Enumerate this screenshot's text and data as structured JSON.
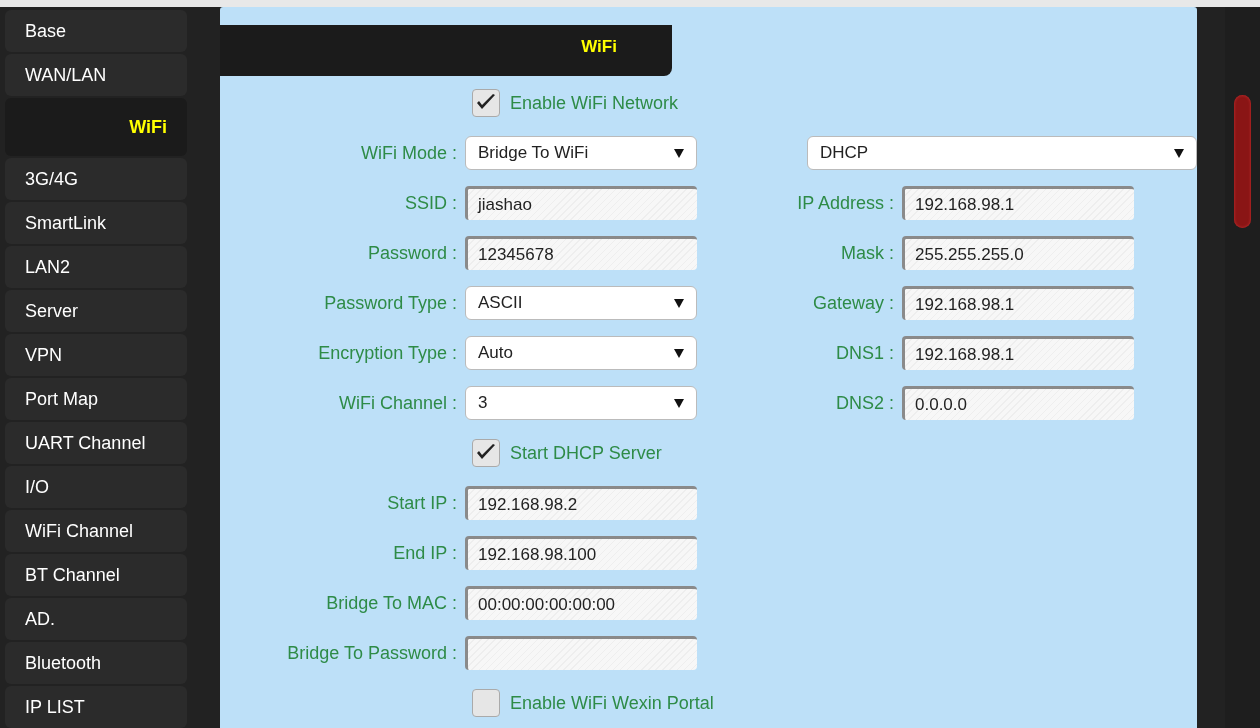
{
  "sidebar": {
    "items": [
      {
        "label": "Base",
        "selected": false
      },
      {
        "label": "WAN/LAN",
        "selected": false
      },
      {
        "label": "WiFi",
        "selected": true
      },
      {
        "label": "3G/4G",
        "selected": false
      },
      {
        "label": "SmartLink",
        "selected": false
      },
      {
        "label": "LAN2",
        "selected": false
      },
      {
        "label": "Server",
        "selected": false
      },
      {
        "label": "VPN",
        "selected": false
      },
      {
        "label": "Port Map",
        "selected": false
      },
      {
        "label": "UART Channel",
        "selected": false
      },
      {
        "label": "I/O",
        "selected": false
      },
      {
        "label": "WiFi Channel",
        "selected": false
      },
      {
        "label": "BT Channel",
        "selected": false
      },
      {
        "label": "AD.",
        "selected": false
      },
      {
        "label": "Bluetooth",
        "selected": false
      },
      {
        "label": "IP LIST",
        "selected": false
      }
    ]
  },
  "panel": {
    "tab": "WiFi",
    "left": [
      {
        "kind": "checkbox",
        "label": "Enable WiFi Network",
        "checked": true
      },
      {
        "kind": "select",
        "label": "WiFi Mode :",
        "value": "Bridge To WiFi"
      },
      {
        "kind": "input",
        "label": "SSID :",
        "value": "jiashao"
      },
      {
        "kind": "input",
        "label": "Password :",
        "value": "12345678"
      },
      {
        "kind": "select",
        "label": "Password Type :",
        "value": "ASCII"
      },
      {
        "kind": "select",
        "label": "Encryption Type :",
        "value": "Auto"
      },
      {
        "kind": "select",
        "label": "WiFi Channel :",
        "value": "3"
      },
      {
        "kind": "checkbox",
        "label": "Start DHCP Server",
        "checked": true
      },
      {
        "kind": "input",
        "label": "Start IP :",
        "value": "192.168.98.2"
      },
      {
        "kind": "input",
        "label": "End IP :",
        "value": "192.168.98.100"
      },
      {
        "kind": "input",
        "label": "Bridge To MAC :",
        "value": "00:00:00:00:00:00"
      },
      {
        "kind": "input",
        "label": "Bridge To Password :"
      },
      {
        "kind": "checkbox",
        "label": "Enable WiFi Wexin Portal",
        "checked": false
      }
    ],
    "right": [
      {
        "kind": "wide_select",
        "value": "DHCP"
      },
      {
        "kind": "input",
        "label": "IP Address :",
        "value": "192.168.98.1"
      },
      {
        "kind": "input",
        "label": "Mask :",
        "value": "255.255.255.0"
      },
      {
        "kind": "input",
        "label": "Gateway :",
        "value": "192.168.98.1"
      },
      {
        "kind": "input",
        "label": "DNS1 :",
        "value": "192.168.98.1"
      },
      {
        "kind": "input",
        "label": "DNS2 :",
        "value": "0.0.0.0"
      }
    ]
  }
}
